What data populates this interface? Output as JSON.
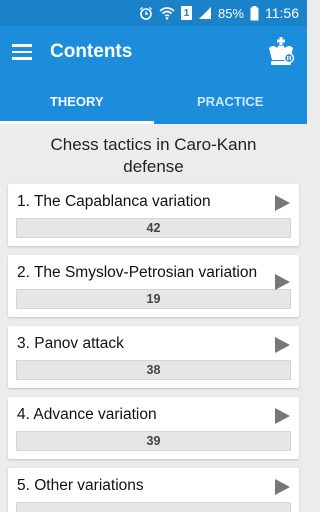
{
  "status_bar": {
    "battery_percent": "85%",
    "time": "11:56",
    "sim_slot": "1"
  },
  "app_bar": {
    "title": "Contents"
  },
  "tabs": [
    {
      "label": "THEORY",
      "active": true
    },
    {
      "label": "PRACTICE",
      "active": false
    }
  ],
  "page": {
    "heading": "Chess tactics in Caro-Kann defense"
  },
  "sections": [
    {
      "title": "1. The Capablanca variation",
      "count": "42"
    },
    {
      "title": "2. The Smyslov-Petrosian variation",
      "count": "19"
    },
    {
      "title": "3. Panov attack",
      "count": "38"
    },
    {
      "title": "4. Advance variation",
      "count": "39"
    },
    {
      "title": "5. Other variations",
      "count": ""
    }
  ],
  "colors": {
    "status_bar": "#1a82c9",
    "app_bar": "#1b8ddb",
    "background": "#ececec"
  }
}
